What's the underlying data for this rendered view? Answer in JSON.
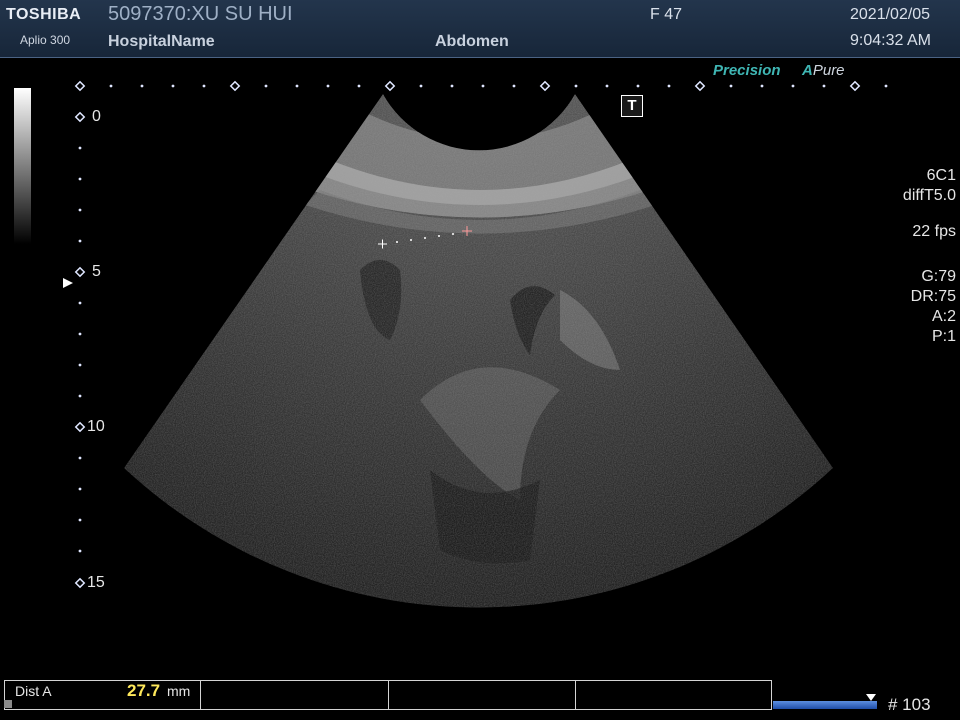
{
  "header": {
    "brand": "TOSHIBA",
    "model": "Aplio 300",
    "patient": "5097370:XU SU HUI",
    "hospital": "HospitalName",
    "sex_age": "F  47",
    "preset": "Abdomen",
    "date": "2021/02/05",
    "time": "9:04:32 AM"
  },
  "tags": {
    "precision": "Precision",
    "apure_a": "A",
    "apure_rest": "Pure"
  },
  "t_button": "T",
  "depth_scale": [
    "0",
    "5",
    "10",
    "15"
  ],
  "params": {
    "probe": "6C1",
    "mode": "diffT5.0",
    "fps": "22 fps",
    "gain": "G:79",
    "dynamic_range": "DR:75",
    "a": "A:2",
    "p": "P:1"
  },
  "measurement": {
    "label": "Dist A",
    "value": "27.7",
    "unit": "mm"
  },
  "cine": {
    "frame": "# 103"
  },
  "colors": {
    "header_bg": "#1c2e45",
    "accent_teal": "#3fb6b4",
    "measure_value": "#ffe95b",
    "cine_blue": "#3a6fd0"
  }
}
